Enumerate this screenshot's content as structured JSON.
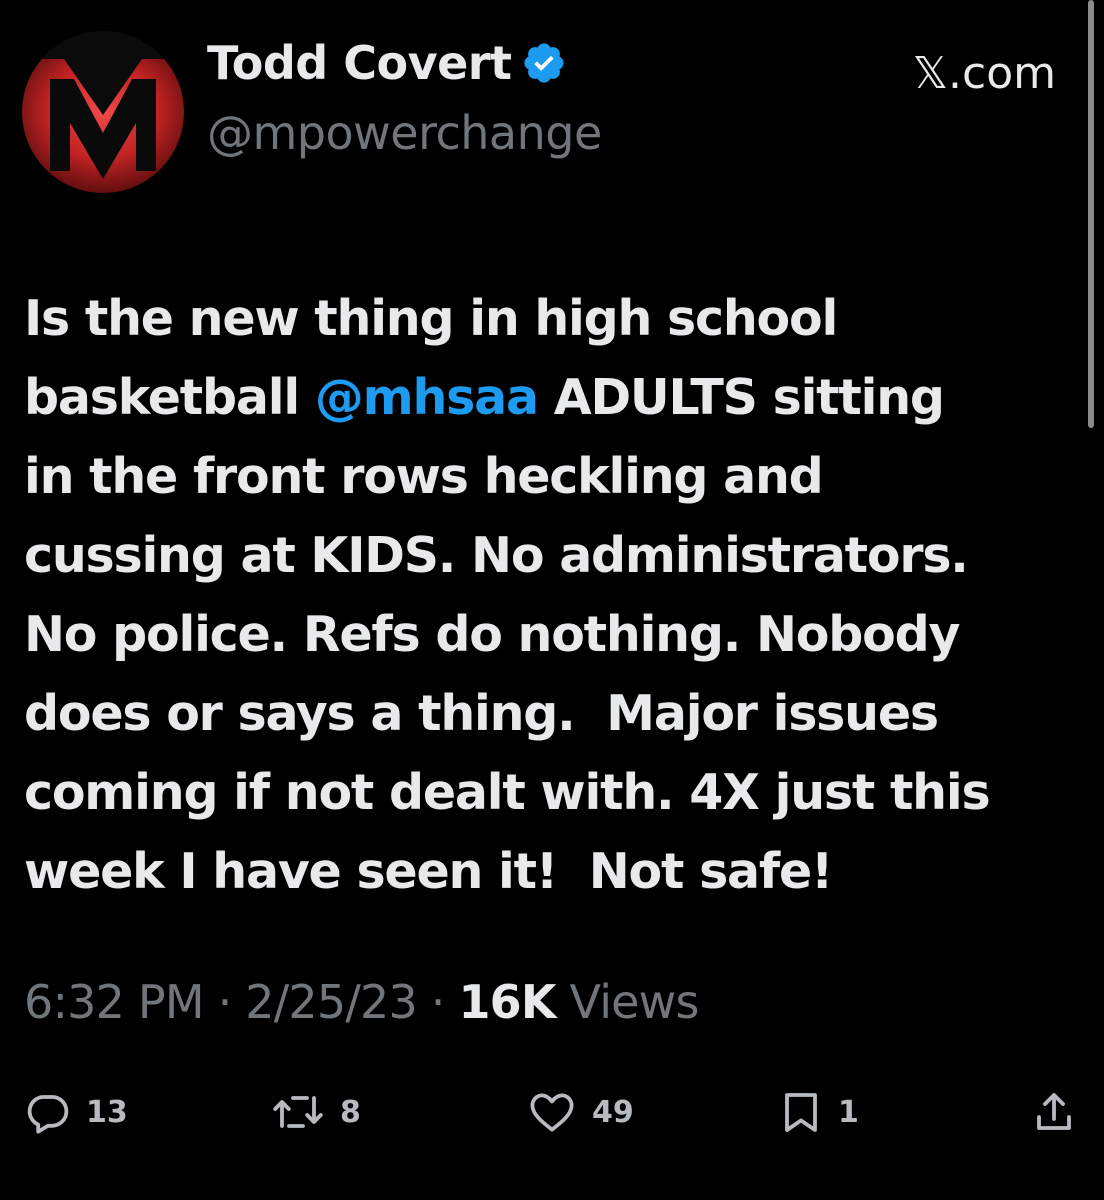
{
  "author": {
    "display_name": "Todd Covert",
    "handle": "@mpowerchange",
    "verified": true
  },
  "source_label": "𝕏.com",
  "tweet": {
    "lines": [
      [
        "Is the new thing in high school"
      ],
      [
        "basketball ",
        "@mhsaa",
        " ADULTS sitting"
      ],
      [
        "in the front rows heckling and"
      ],
      [
        "cussing at KIDS. No administrators."
      ],
      [
        "No police. Refs do nothing. Nobody"
      ],
      [
        "does or says a thing.  Major issues"
      ],
      [
        "coming if not dealt with. 4X just this"
      ],
      [
        "week I have seen it!  Not safe!"
      ]
    ],
    "mention": "@mhsaa"
  },
  "meta": {
    "time": "6:32 PM",
    "date": "2/25/23",
    "views_count": "16K",
    "views_label": "Views",
    "separator": "·"
  },
  "actions": {
    "replies": "13",
    "reposts": "8",
    "likes": "49",
    "bookmarks": "1"
  },
  "colors": {
    "background": "#000000",
    "text": "#e7e9ea",
    "muted": "#71767b",
    "accent": "#1d9bf0",
    "avatar_red": "#d62d2d"
  },
  "icons": {
    "verified": "verified-badge-icon",
    "reply": "reply-icon",
    "repost": "repost-icon",
    "like": "heart-icon",
    "bookmark": "bookmark-icon",
    "share": "share-icon"
  }
}
